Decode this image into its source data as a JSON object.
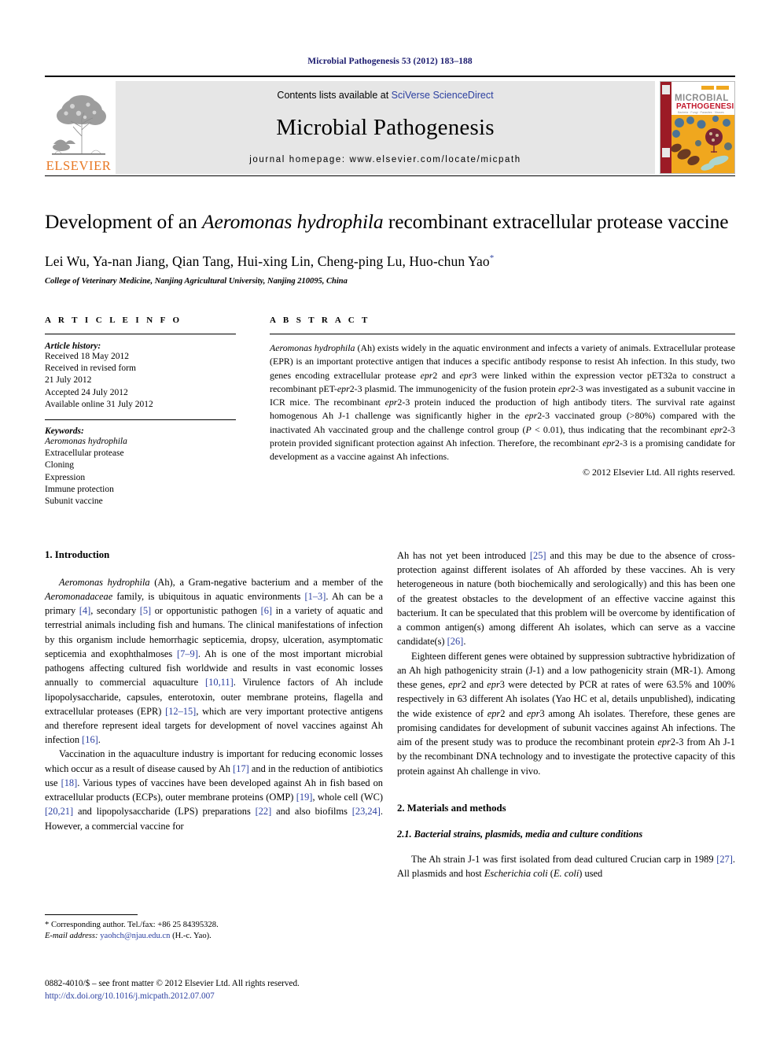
{
  "running_head": "Microbial Pathogenesis 53 (2012) 183–188",
  "masthead": {
    "publisher_name": "ELSEVIER",
    "contents_prefix": "Contents lists available at ",
    "contents_link": "SciVerse ScienceDirect",
    "journal_title": "Microbial Pathogenesis",
    "homepage": "journal homepage: www.elsevier.com/locate/micpath",
    "cover": {
      "title_line1": "MICROBIAL",
      "title_line2": "PATHOGENESIS",
      "subtitle": "Bacteria · Fungi · Parasites · Viruses"
    },
    "colors": {
      "banner_bg": "#e6e6e6",
      "link_blue": "#2b3fa0",
      "elsevier_orange": "#e87722",
      "cover_red": "#9c1b26",
      "cover_yellow": "#f0a71e"
    }
  },
  "article": {
    "title_part1": "Development of an ",
    "title_italic": "Aeromonas hydrophila",
    "title_part2": " recombinant extracellular protease vaccine",
    "authors": "Lei Wu, Ya-nan Jiang, Qian Tang, Hui-xing Lin, Cheng-ping Lu, Huo-chun Yao",
    "author_marker": "*",
    "affiliation": "College of Veterinary Medicine, Nanjing Agricultural University, Nanjing 210095, China"
  },
  "article_info": {
    "heading": "A R T I C L E   I N F O",
    "history_label": "Article history:",
    "history": [
      "Received 18 May 2012",
      "Received in revised form",
      "21 July 2012",
      "Accepted 24 July 2012",
      "Available online 31 July 2012"
    ],
    "keywords_label": "Keywords:",
    "keywords": [
      {
        "text": "Aeromonas hydrophila",
        "italic": true
      },
      {
        "text": "Extracellular protease",
        "italic": false
      },
      {
        "text": "Cloning",
        "italic": false
      },
      {
        "text": "Expression",
        "italic": false
      },
      {
        "text": "Immune protection",
        "italic": false
      },
      {
        "text": "Subunit vaccine",
        "italic": false
      }
    ]
  },
  "abstract": {
    "heading": "A B S T R A C T",
    "body_html": "<span class=\"it\">Aeromonas hydrophila</span> (Ah) exists widely in the aquatic environment and infects a variety of animals. Extracellular protease (EPR) is an important protective antigen that induces a specific antibody response to resist Ah infection. In this study, two genes encoding extracellular protease <span class=\"it\">epr</span>2 and <span class=\"it\">epr</span>3 were linked within the expression vector pET32a to construct a recombinant pET-<span class=\"it\">epr</span>2-3 plasmid. The immunogenicity of the fusion protein <span class=\"it\">epr</span>2-3 was investigated as a subunit vaccine in ICR mice. The recombinant <span class=\"it\">epr</span>2-3 protein induced the production of high antibody titers. The survival rate against homogenous Ah J-1 challenge was significantly higher in the <span class=\"it\">epr</span>2-3 vaccinated group (&gt;80%) compared with the inactivated Ah vaccinated group and the challenge control group (<span class=\"it\">P</span> &lt; 0.01), thus indicating that the recombinant <span class=\"it\">epr</span>2-3 protein provided significant protection against Ah infection. Therefore, the recombinant <span class=\"it\">epr</span>2-3 is a promising candidate for development as a vaccine against Ah infections.",
    "copyright": "© 2012 Elsevier Ltd. All rights reserved."
  },
  "sections": {
    "introduction_heading": "1. Introduction",
    "intro_p1_html": "<span class=\"it\">Aeromonas hydrophila</span> (Ah), a Gram-negative bacterium and a member of the <span class=\"it\">Aeromonadaceae</span> family, is ubiquitous in aquatic environments <span class=\"ref\">[1&#8211;3]</span>. Ah can be a primary <span class=\"ref\">[4]</span>, secondary <span class=\"ref\">[5]</span> or opportunistic pathogen <span class=\"ref\">[6]</span> in a variety of aquatic and terrestrial animals including fish and humans. The clinical manifestations of infection by this organism include hemorrhagic septicemia, dropsy, ulceration, asymptomatic septicemia and exophthalmoses <span class=\"ref\">[7&#8211;9]</span>. Ah is one of the most important microbial pathogens affecting cultured fish worldwide and results in vast economic losses annually to commercial aquaculture <span class=\"ref\">[10,11]</span>. Virulence factors of Ah include lipopolysaccharide, capsules, enterotoxin, outer membrane proteins, flagella and extracellular proteases (EPR) <span class=\"ref\">[12&#8211;15]</span>, which are very important protective antigens and therefore represent ideal targets for development of novel vaccines against Ah infection <span class=\"ref\">[16]</span>.",
    "intro_p2_html": "Vaccination in the aquaculture industry is important for reducing economic losses which occur as a result of disease caused by Ah <span class=\"ref\">[17]</span> and in the reduction of antibiotics use <span class=\"ref\">[18]</span>. Various types of vaccines have been developed against Ah in fish based on extracellular products (ECPs), outer membrane proteins (OMP) <span class=\"ref\">[19]</span>, whole cell (WC) <span class=\"ref\">[20,21]</span> and lipopolysaccharide (LPS) preparations <span class=\"ref\">[22]</span> and also biofilms <span class=\"ref\">[23,24]</span>. However, a commercial vaccine for",
    "intro_p2_cont_html": "Ah has not yet been introduced <span class=\"ref\">[25]</span> and this may be due to the absence of cross-protection against different isolates of Ah afforded by these vaccines. Ah is very heterogeneous in nature (both biochemically and serologically) and this has been one of the greatest obstacles to the development of an effective vaccine against this bacterium. It can be speculated that this problem will be overcome by identification of a common antigen(s) among different Ah isolates, which can serve as a vaccine candidate(s) <span class=\"ref\">[26]</span>.",
    "intro_p3_html": "Eighteen different genes were obtained by suppression subtractive hybridization of an Ah high pathogenicity strain (J-1) and a low pathogenicity strain (MR-1). Among these genes, <span class=\"it\">epr</span>2 and <span class=\"it\">epr</span>3 were detected by PCR at rates of were 63.5% and 100% respectively in 63 different Ah isolates (Yao HC et al, details unpublished), indicating the wide existence of <span class=\"it\">epr</span>2 and <span class=\"it\">epr</span>3 among Ah isolates. Therefore, these genes are promising candidates for development of subunit vaccines against Ah infections. The aim of the present study was to produce the recombinant protein <span class=\"it\">epr</span>2-3 from Ah J-1 by the recombinant DNA technology and to investigate the protective capacity of this protein against Ah challenge in vivo.",
    "methods_heading": "2. Materials and methods",
    "methods_subheading": "2.1. Bacterial strains, plasmids, media and culture conditions",
    "methods_p1_html": "The Ah strain J-1 was first isolated from dead cultured Crucian carp in 1989 <span class=\"ref\">[27]</span>. All plasmids and host <span class=\"it\">Escherichia coli</span> (<span class=\"it\">E. coli</span>) used"
  },
  "footnotes": {
    "corresponding_html": "* Corresponding author. Tel./fax: +86 25 84395328.",
    "email_html": "<span class=\"it\">E-mail address:</span> <a href=\"#\">yaohch@njau.edu.cn</a> (H.-c. Yao).",
    "frontmatter_html": "0882-4010/$ &#8211; see front matter © 2012 Elsevier Ltd. All rights reserved.",
    "doi": "http://dx.doi.org/10.1016/j.micpath.2012.07.007"
  }
}
